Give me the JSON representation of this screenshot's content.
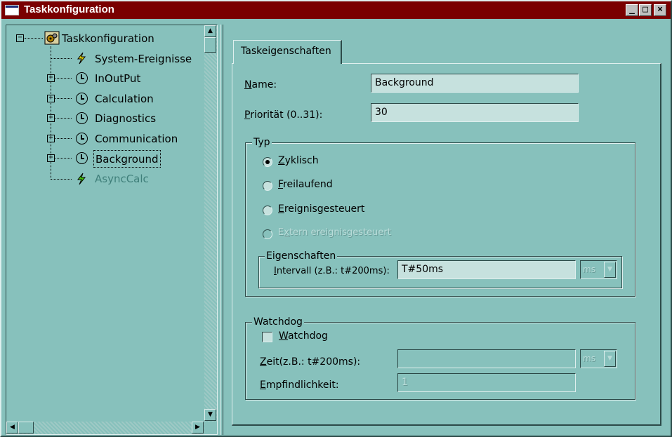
{
  "window": {
    "title": "Taskkonfiguration",
    "controls": [
      "_",
      "□",
      "×"
    ]
  },
  "tree": {
    "root": "Taskkonfiguration",
    "items": [
      {
        "label": "System-Ereignisse",
        "icon": "bolt-icon"
      },
      {
        "label": "InOutPut",
        "icon": "clock-icon"
      },
      {
        "label": "Calculation",
        "icon": "clock-icon"
      },
      {
        "label": "Diagnostics",
        "icon": "clock-icon"
      },
      {
        "label": "Communication",
        "icon": "clock-icon"
      },
      {
        "label": "Background",
        "icon": "clock-icon"
      },
      {
        "label": "AsyncCalc",
        "icon": "bolt-icon"
      }
    ],
    "selected": "Background"
  },
  "tabs": [
    {
      "label": "Taskeigenschaften"
    }
  ],
  "form": {
    "name_label_u": "N",
    "name_label_rest": "ame:",
    "name_value": "Background",
    "prio_label_u": "P",
    "prio_label_rest": "riorität (0..31):",
    "prio_value": "30",
    "typ": {
      "title": "Typ",
      "options": [
        {
          "u": "Z",
          "rest": "yklisch",
          "checked": true,
          "disabled": false
        },
        {
          "u": "F",
          "rest": "reilaufend",
          "checked": false,
          "disabled": false
        },
        {
          "u": "E",
          "rest": "reignisgesteuert",
          "checked": false,
          "disabled": false
        },
        {
          "u": "x",
          "pre": "E",
          "rest": "tern ereignisgesteuert",
          "checked": false,
          "disabled": true
        }
      ],
      "eigenschaften": {
        "title": "Eigenschaften",
        "interval_label_u": "I",
        "interval_label_rest": "ntervall (z.B.: t#200ms):",
        "interval_value": "T#50ms",
        "unit": "ms"
      }
    },
    "watchdog": {
      "title": "Watchdog",
      "checkbox_u": "W",
      "checkbox_rest": "atchdog",
      "zeit_label_u": "Z",
      "zeit_label_rest": "eit(z.B.: t#200ms):",
      "zeit_value": "",
      "unit": "ms",
      "empf_label_u": "E",
      "empf_label_rest": "mpfindlichkeit:",
      "empf_value": "1"
    }
  }
}
